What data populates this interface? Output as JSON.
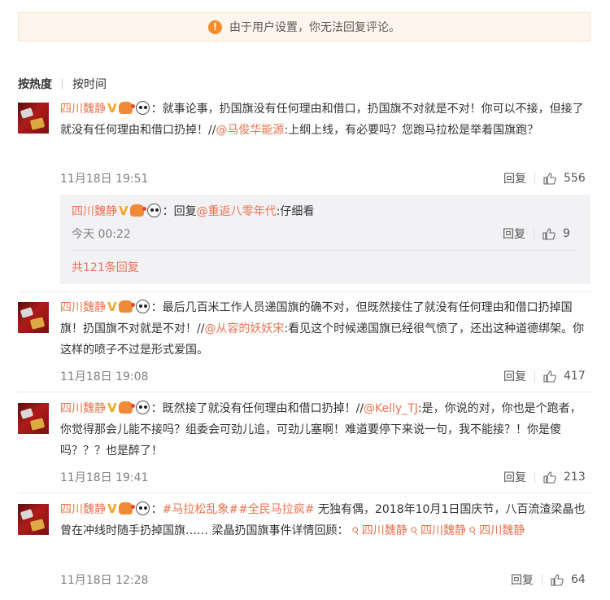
{
  "notice": {
    "text": "由于用户设置，你无法回复评论。"
  },
  "sort": {
    "hot": "按热度",
    "time": "按时间"
  },
  "reply_label": "回复",
  "comments": [
    {
      "user": "四川魏静",
      "sep": "：",
      "text1": "就事论事，扔国旗没有任何理由和借口，扔国旗不对就是不对！你可以不接，但接了就没有任何理由和借口扔掉！//",
      "mention": "@马俊华能源",
      "text2": ":上纲上线，有必要吗？您跑马拉松是举着国旗跑？",
      "time": "11月18日 19:51",
      "likes": "556"
    },
    {
      "user": "四川魏静",
      "sep": "：",
      "text1": "最后几百米工作人员递国旗的确不对，但既然接住了就没有任何理由和借口扔掉国旗！扔国旗不对就是不对！//",
      "mention": "@从容的妖妖宋",
      "text2": ":看见这个时候递国旗已经很气愤了，还出这种道德绑架。你这样的喷子不过是形式爱国。",
      "time": "11月18日 19:08",
      "likes": "417"
    },
    {
      "user": "四川魏静",
      "sep": "：",
      "text1": "既然接了就没有任何理由和借口扔掉！//",
      "mention": "@Kelly_TJ",
      "text2": ":是，你说的对，你也是个跑者，你觉得那会儿能不接吗？组委会可劲儿追，可劲儿塞啊！难道要停下来说一句，我不能接？！你是傻吗？？？也是醉了！",
      "time": "11月18日 19:41",
      "likes": "213"
    },
    {
      "user": "四川魏静",
      "sep": "：",
      "tag1": "#马拉松乱象#",
      "tag2": "#全民马拉疯#",
      "text1": " 无独有偶，2018年10月1日国庆节，八百流渣梁晶也曾在冲线时随手扔掉国旗…… 梁晶扔国旗事件详情回顾：",
      "link1": "四川魏静",
      "link2": "四川魏静",
      "link3": "四川魏静",
      "time": "11月18日 12:28",
      "likes": "64"
    }
  ],
  "reply": {
    "user": "四川魏静",
    "sep": "：",
    "prefix": "回复",
    "mention": "@重返八零年代",
    "text": ":仔细看",
    "time": "今天 00:22",
    "likes": "9",
    "more": "共121条回复"
  },
  "colors": {
    "accent": "#eb7350",
    "notice_bg": "#fef6ec",
    "reply_bg": "#f2f2f5"
  }
}
